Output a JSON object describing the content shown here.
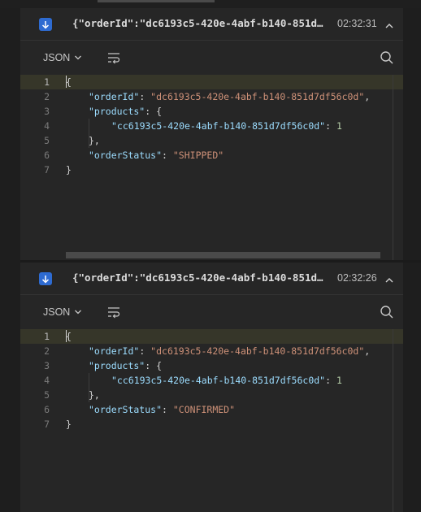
{
  "messages": [
    {
      "title": "{\"orderId\":\"dc6193c5-420e-4abf-b140-851d7…",
      "time": "02:32:31",
      "format": "JSON",
      "lines": [
        {
          "num": "1",
          "parts": [
            {
              "t": "p",
              "v": "{"
            }
          ]
        },
        {
          "num": "2",
          "parts": [
            {
              "t": "k",
              "v": "\"orderId\""
            },
            {
              "t": "p",
              "v": ": "
            },
            {
              "t": "s",
              "v": "\"dc6193c5-420e-4abf-b140-851d7df56c0d\""
            },
            {
              "t": "p",
              "v": ","
            }
          ]
        },
        {
          "num": "3",
          "parts": [
            {
              "t": "k",
              "v": "\"products\""
            },
            {
              "t": "p",
              "v": ": {"
            }
          ]
        },
        {
          "num": "4",
          "parts": [
            {
              "t": "k",
              "v": "\"cc6193c5-420e-4abf-b140-851d7df56c0d\""
            },
            {
              "t": "p",
              "v": ": "
            },
            {
              "t": "n",
              "v": "1"
            }
          ]
        },
        {
          "num": "5",
          "parts": [
            {
              "t": "p",
              "v": "},"
            }
          ]
        },
        {
          "num": "6",
          "parts": [
            {
              "t": "k",
              "v": "\"orderStatus\""
            },
            {
              "t": "p",
              "v": ": "
            },
            {
              "t": "s",
              "v": "\"SHIPPED\""
            }
          ]
        },
        {
          "num": "7",
          "parts": [
            {
              "t": "p",
              "v": "}"
            }
          ]
        }
      ]
    },
    {
      "title": "{\"orderId\":\"dc6193c5-420e-4abf-b140-851d…",
      "time": "02:32:26",
      "format": "JSON",
      "lines": [
        {
          "num": "1",
          "parts": [
            {
              "t": "p",
              "v": "{"
            }
          ]
        },
        {
          "num": "2",
          "parts": [
            {
              "t": "k",
              "v": "\"orderId\""
            },
            {
              "t": "p",
              "v": ": "
            },
            {
              "t": "s",
              "v": "\"dc6193c5-420e-4abf-b140-851d7df56c0d\""
            },
            {
              "t": "p",
              "v": ","
            }
          ]
        },
        {
          "num": "3",
          "parts": [
            {
              "t": "k",
              "v": "\"products\""
            },
            {
              "t": "p",
              "v": ": {"
            }
          ]
        },
        {
          "num": "4",
          "parts": [
            {
              "t": "k",
              "v": "\"cc6193c5-420e-4abf-b140-851d7df56c0d\""
            },
            {
              "t": "p",
              "v": ": "
            },
            {
              "t": "n",
              "v": "1"
            }
          ]
        },
        {
          "num": "5",
          "parts": [
            {
              "t": "p",
              "v": "},"
            }
          ]
        },
        {
          "num": "6",
          "parts": [
            {
              "t": "k",
              "v": "\"orderStatus\""
            },
            {
              "t": "p",
              "v": ": "
            },
            {
              "t": "s",
              "v": "\"CONFIRMED\""
            }
          ]
        },
        {
          "num": "7",
          "parts": [
            {
              "t": "p",
              "v": "}"
            }
          ]
        }
      ]
    }
  ],
  "icons": {
    "direction": "arrow-down-icon",
    "collapse": "chevron-up-icon",
    "format_dropdown": "chevron-down-icon",
    "wrap": "word-wrap-icon",
    "search": "search-icon"
  },
  "colors": {
    "accent": "#2e6bd1",
    "key": "#9cdcfe",
    "string": "#ce9178",
    "number": "#b5cea8",
    "active_line": "#363629"
  }
}
